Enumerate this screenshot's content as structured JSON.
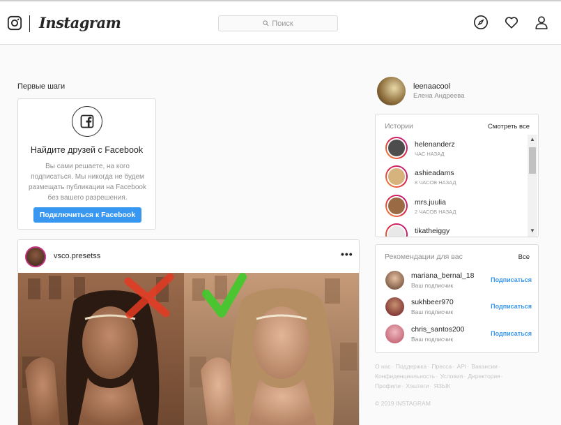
{
  "header": {
    "logo_text": "Instagram",
    "search_placeholder": "Поиск",
    "icons": [
      "instagram-camera-icon",
      "explore-compass-icon",
      "activity-heart-icon",
      "profile-person-icon"
    ]
  },
  "left": {
    "section_label": "Первые шаги",
    "facebook_card": {
      "title": "Найдите друзей с Facebook",
      "description": "Вы сами решаете, на кого подписаться. Мы никогда не будем размещать публикации на Facebook без вашего разрешения.",
      "button_label": "Подключиться к Facebook"
    },
    "post": {
      "username": "vsco.presetss",
      "more_label": "•••"
    }
  },
  "profile": {
    "username": "leenaacool",
    "full_name": "Елена Андреева"
  },
  "stories": {
    "title": "Истории",
    "see_all": "Смотреть все",
    "items": [
      {
        "username": "helenanderz",
        "time": "час назад"
      },
      {
        "username": "ashieadams",
        "time": "8 часов назад"
      },
      {
        "username": "mrs.juulia",
        "time": "2 часов назад"
      },
      {
        "username": "tikatheiggy",
        "time": ""
      }
    ]
  },
  "recommendations": {
    "title": "Рекомендации для вас",
    "all_label": "Все",
    "items": [
      {
        "username": "mariana_bernal_18",
        "subtitle": "Ваш подписчик",
        "action": "Подписаться"
      },
      {
        "username": "sukhbeer970",
        "subtitle": "Ваш подписчик",
        "action": "Подписаться"
      },
      {
        "username": "chris_santos200",
        "subtitle": "Ваш подписчик",
        "action": "Подписаться"
      }
    ]
  },
  "footer": {
    "links": [
      "О нас",
      "Поддержка",
      "Пресса",
      "API",
      "Вакансии",
      "Конфиденциальность",
      "Условия",
      "Директория",
      "Профили",
      "Хэштеги",
      "ЯЗЫК"
    ],
    "copyright": "© 2019 INSTAGRAM"
  },
  "colors": {
    "accent_blue": "#3897f0",
    "border": "#dbdbdb",
    "background": "#fafafa"
  }
}
